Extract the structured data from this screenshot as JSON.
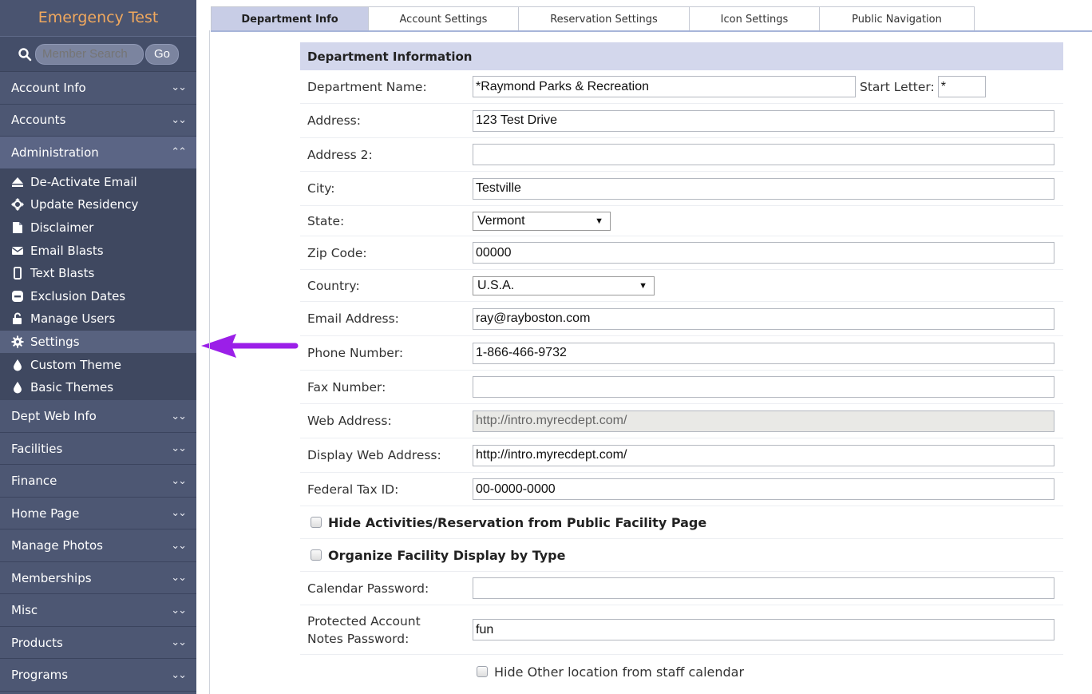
{
  "app": {
    "title": "Emergency Test"
  },
  "search": {
    "placeholder": "Member Search",
    "go_label": "Go"
  },
  "sidebar": {
    "sections_top": [
      {
        "label": "Account Info",
        "chevron": "double-chevron-down-icon"
      },
      {
        "label": "Accounts",
        "chevron": "double-chevron-down-icon"
      }
    ],
    "admin": {
      "label": "Administration",
      "chevron": "double-chevron-up-icon",
      "items": [
        {
          "label": "De-Activate Email",
          "icon": "eject-icon"
        },
        {
          "label": "Update Residency",
          "icon": "move-arrows-icon"
        },
        {
          "label": "Disclaimer",
          "icon": "file-icon"
        },
        {
          "label": "Email Blasts",
          "icon": "envelope-icon"
        },
        {
          "label": "Text Blasts",
          "icon": "mobile-phone-icon"
        },
        {
          "label": "Exclusion Dates",
          "icon": "minus-circle-icon"
        },
        {
          "label": "Manage Users",
          "icon": "unlock-icon"
        },
        {
          "label": "Settings",
          "icon": "gear-icon",
          "active": true
        },
        {
          "label": "Custom Theme",
          "icon": "droplet-icon"
        },
        {
          "label": "Basic Themes",
          "icon": "droplet-icon"
        }
      ]
    },
    "sections_bottom": [
      {
        "label": "Dept Web Info"
      },
      {
        "label": "Facilities"
      },
      {
        "label": "Finance"
      },
      {
        "label": "Home Page"
      },
      {
        "label": "Manage Photos"
      },
      {
        "label": "Memberships"
      },
      {
        "label": "Misc"
      },
      {
        "label": "Products"
      },
      {
        "label": "Programs"
      }
    ]
  },
  "tabs": [
    {
      "label": "Department Info",
      "active": true
    },
    {
      "label": "Account Settings"
    },
    {
      "label": "Reservation Settings"
    },
    {
      "label": "Icon Settings"
    },
    {
      "label": "Public Navigation"
    }
  ],
  "form": {
    "header": "Department Information",
    "department_name": {
      "label": "Department Name:",
      "value": "*Raymond Parks & Recreation"
    },
    "start_letter": {
      "label": "Start Letter:",
      "value": "*"
    },
    "address": {
      "label": "Address:",
      "value": "123 Test Drive"
    },
    "address2": {
      "label": "Address 2:",
      "value": ""
    },
    "city": {
      "label": "City:",
      "value": "Testville"
    },
    "state": {
      "label": "State:",
      "value": "Vermont"
    },
    "zip": {
      "label": "Zip Code:",
      "value": "00000"
    },
    "country": {
      "label": "Country:",
      "value": "U.S.A."
    },
    "email": {
      "label": "Email Address:",
      "value": "ray@rayboston.com"
    },
    "phone": {
      "label": "Phone Number:",
      "value": "1-866-466-9732"
    },
    "fax": {
      "label": "Fax Number:",
      "value": ""
    },
    "web_address": {
      "label": "Web Address:",
      "value": "http://intro.myrecdept.com/"
    },
    "display_web_address": {
      "label": "Display Web Address:",
      "value": "http://intro.myrecdept.com/"
    },
    "federal_tax_id": {
      "label": "Federal Tax ID:",
      "value": "00-0000-0000"
    },
    "hide_activities": {
      "label": "Hide Activities/Reservation from Public Facility Page",
      "checked": false
    },
    "organize_facility": {
      "label": "Organize Facility Display by Type",
      "checked": false
    },
    "calendar_password": {
      "label": "Calendar Password:",
      "value": ""
    },
    "protected_password": {
      "label_line1": "Protected Account",
      "label_line2": "Notes Password:",
      "value": "fun"
    },
    "hide_other_location": {
      "label": "Hide Other location from staff calendar",
      "checked": false
    }
  },
  "colors": {
    "sidebar_bg": "#4d5773",
    "title_color": "#f0a85e",
    "active_tab_bg": "#c8cde6",
    "panel_header_bg": "#d3d7ec",
    "arrow_color": "#9b1fe8"
  }
}
